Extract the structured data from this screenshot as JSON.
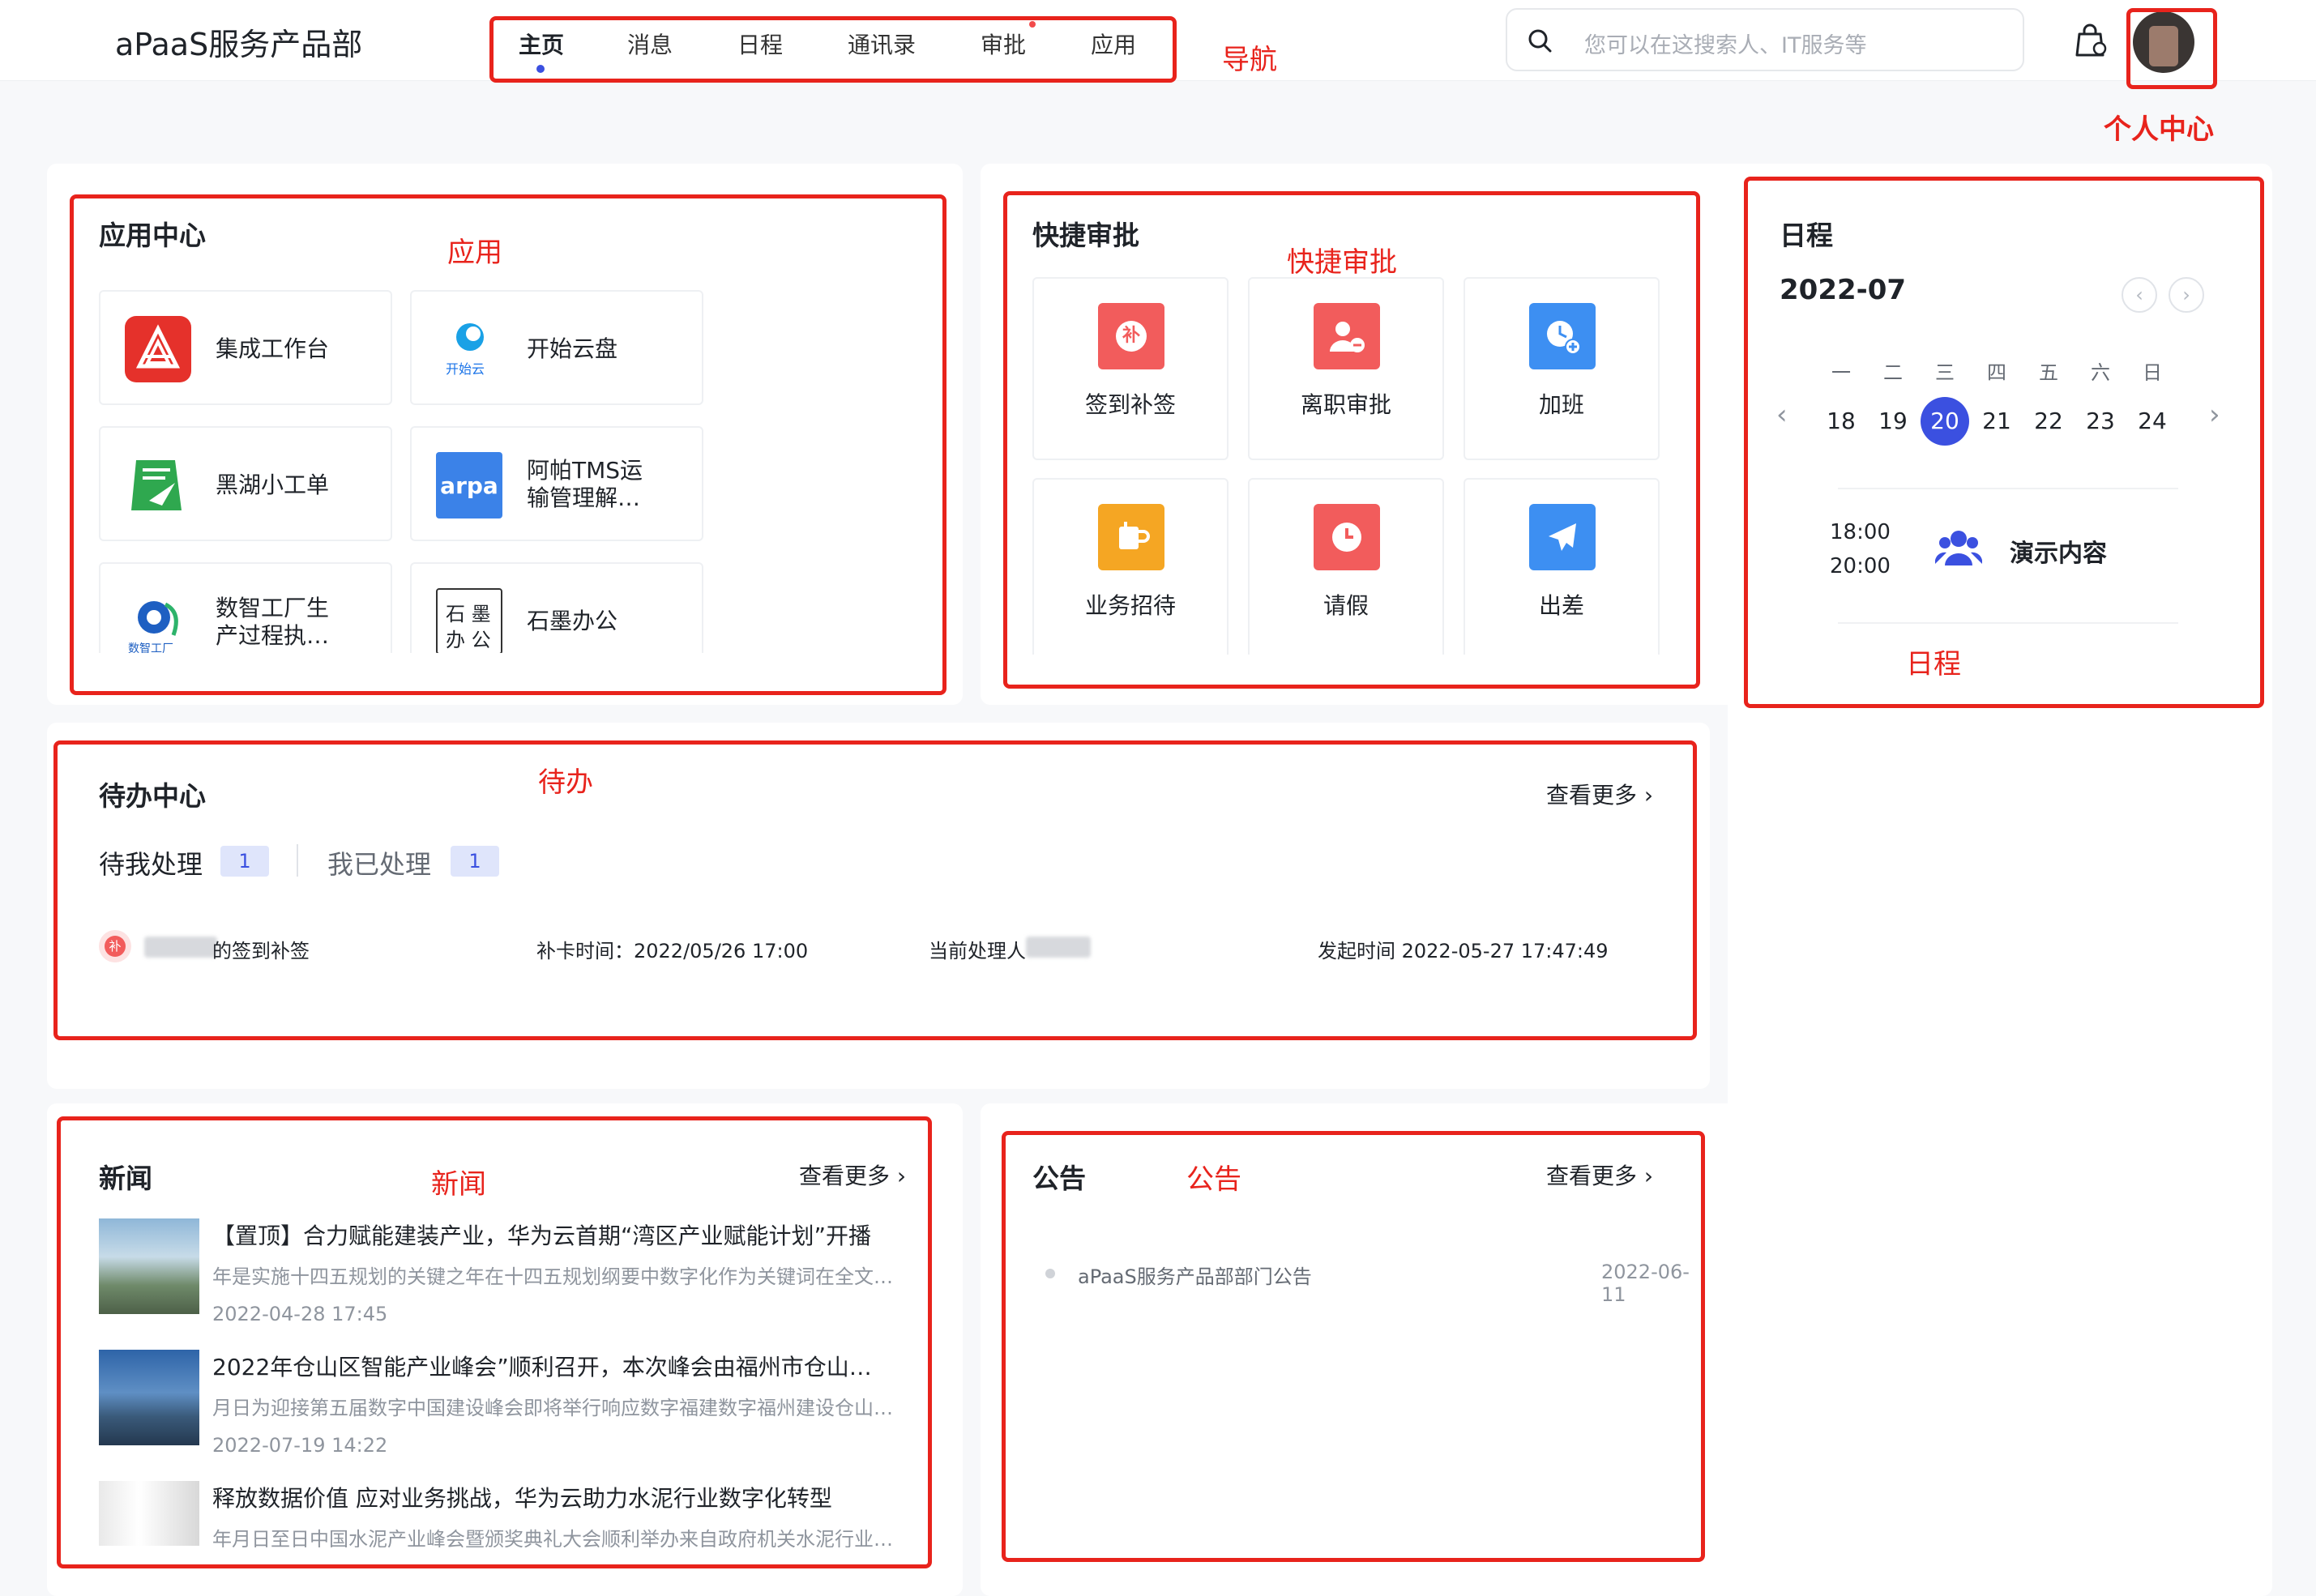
{
  "header": {
    "brand": "aPaaS服务产品部",
    "nav": [
      "主页",
      "消息",
      "日程",
      "通讯录",
      "审批",
      "应用"
    ],
    "search_placeholder": "您可以在这搜索人、IT服务等"
  },
  "annotations": {
    "nav": "导航",
    "profile": "个人中心",
    "apps": "应用",
    "quick": "快捷审批",
    "schedule": "日程",
    "todo": "待办",
    "news": "新闻",
    "notice": "公告"
  },
  "apps": {
    "title": "应用中心",
    "items": [
      {
        "name1": "集成工作台",
        "name2": ""
      },
      {
        "name1": "开始云盘",
        "name2": ""
      },
      {
        "name1": "黑湖小工单",
        "name2": ""
      },
      {
        "name1": "阿帕TMS运",
        "name2": "输管理解…"
      },
      {
        "name1": "数智工厂生",
        "name2": "产过程执…"
      },
      {
        "name1": "石墨办公",
        "name2": ""
      }
    ],
    "logo_texts": {
      "kaishi": "开始云",
      "arpa": "arpa",
      "shimo1": "石 墨",
      "shimo2": "办 公",
      "shuzhi": "数智工厂"
    }
  },
  "quick": {
    "title": "快捷审批",
    "items": [
      "签到补签",
      "离职审批",
      "加班",
      "业务招待",
      "请假",
      "出差"
    ],
    "icon_glyph": "补"
  },
  "schedule": {
    "title": "日程",
    "month": "2022-07",
    "weekdays": [
      "一",
      "二",
      "三",
      "四",
      "五",
      "六",
      "日"
    ],
    "days": [
      "18",
      "19",
      "20",
      "21",
      "22",
      "23",
      "24"
    ],
    "selected": "20",
    "event": {
      "start": "18:00",
      "end": "20:00",
      "title": "演示内容"
    }
  },
  "todo": {
    "title": "待办中心",
    "more": "查看更多",
    "tabs": [
      {
        "label": "待我处理",
        "count": "1"
      },
      {
        "label": "我已处理",
        "count": "1"
      }
    ],
    "row": {
      "icon": "补",
      "name": "的签到补签",
      "punch": "补卡时间：2022/05/26 17:00",
      "handler": "当前处理人",
      "started": "发起时间 2022-05-27 17:47:49"
    }
  },
  "news": {
    "title": "新闻",
    "more": "查看更多",
    "items": [
      {
        "title": "【置顶】合力赋能建装产业，华为云首期“湾区产业赋能计划”开播",
        "summary": "年是实施十四五规划的关键之年在十四五规划纲要中数字化作为关键词在全文…",
        "date": "2022-04-28 17:45"
      },
      {
        "title": "2022年仓山区智能产业峰会”顺利召开，本次峰会由福州市仓山…",
        "summary": "月日为迎接第五届数字中国建设峰会即将举行响应数字福建数字福州建设仓山…",
        "date": "2022-07-19 14:22"
      },
      {
        "title": "释放数据价值 应对业务挑战，华为云助力水泥行业数字化转型",
        "summary": "年月日至日中国水泥产业峰会暨颁奖典礼大会顺利举办来自政府机关水泥行业…",
        "date": ""
      }
    ]
  },
  "notice": {
    "title": "公告",
    "more": "查看更多",
    "items": [
      {
        "title": "aPaaS服务产品部部门公告",
        "date": "2022-06-11"
      }
    ]
  }
}
